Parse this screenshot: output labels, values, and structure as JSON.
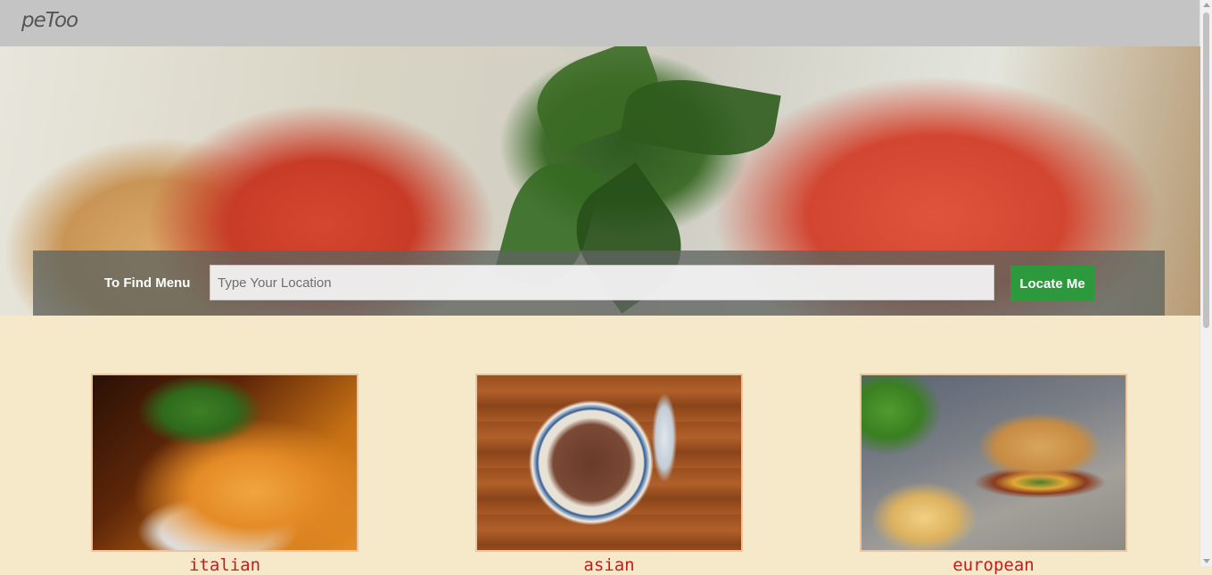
{
  "brand": {
    "logo_text": "peToo"
  },
  "search": {
    "label": "To Find Menu",
    "placeholder": "Type Your Location",
    "value": "",
    "button_label": "Locate Me"
  },
  "cuisines": [
    {
      "label": "italian"
    },
    {
      "label": "asian"
    },
    {
      "label": "european"
    }
  ],
  "colors": {
    "navbar": "#c4c4c4",
    "page_background": "#f6e9c9",
    "button": "#2c9a3c",
    "cuisine_label": "#c41d1d",
    "card_border": "#ecc49d"
  }
}
